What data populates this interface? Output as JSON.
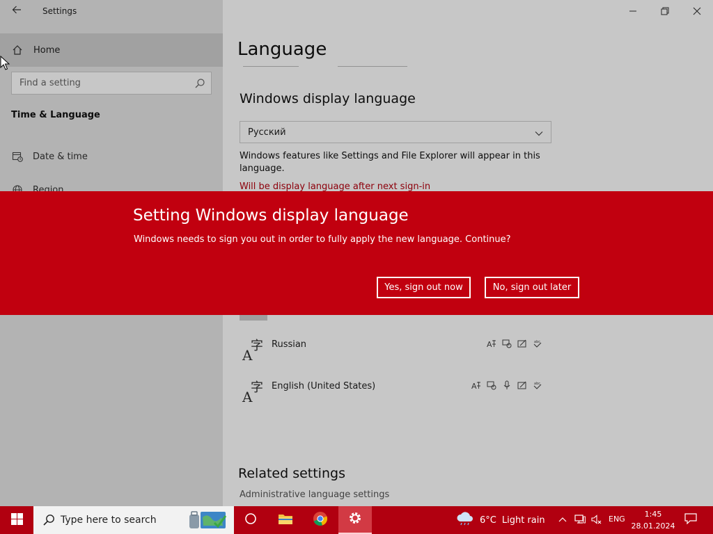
{
  "window": {
    "app_title": "Settings"
  },
  "sidebar": {
    "home_label": "Home",
    "search_placeholder": "Find a setting",
    "section_heading": "Time & Language",
    "items": [
      {
        "label": "Date & time",
        "icon": "calendar-clock-icon"
      },
      {
        "label": "Region",
        "icon": "globe-icon"
      }
    ]
  },
  "main": {
    "page_title": "Language",
    "display_language_heading": "Windows display language",
    "display_language_value": "Русский",
    "description": "Windows features like Settings and File Explorer will appear in this language.",
    "pending_note": "Will be display language after next sign-in",
    "preferred_languages": [
      {
        "name": "Russian",
        "features": [
          "display-language-icon",
          "text-to-speech-icon",
          "handwriting-icon",
          "spellcheck-icon"
        ]
      },
      {
        "name": "English (United States)",
        "features": [
          "display-language-icon",
          "text-to-speech-icon",
          "microphone-icon",
          "handwriting-icon",
          "spellcheck-icon"
        ]
      }
    ],
    "related_heading": "Related settings",
    "admin_link": "Administrative language settings"
  },
  "dialog": {
    "title": "Setting Windows display language",
    "message": "Windows needs to sign you out in order to fully apply the new language. Continue?",
    "yes_label": "Yes, sign out now",
    "no_label": "No, sign out later",
    "accent_color": "#c1000f"
  },
  "taskbar": {
    "search_text": "Type here to search",
    "weather": {
      "temp": "6°C",
      "condition": "Light rain"
    },
    "language": "ENG",
    "time": "1:45",
    "date": "28.01.2024",
    "color": "#b10010"
  }
}
